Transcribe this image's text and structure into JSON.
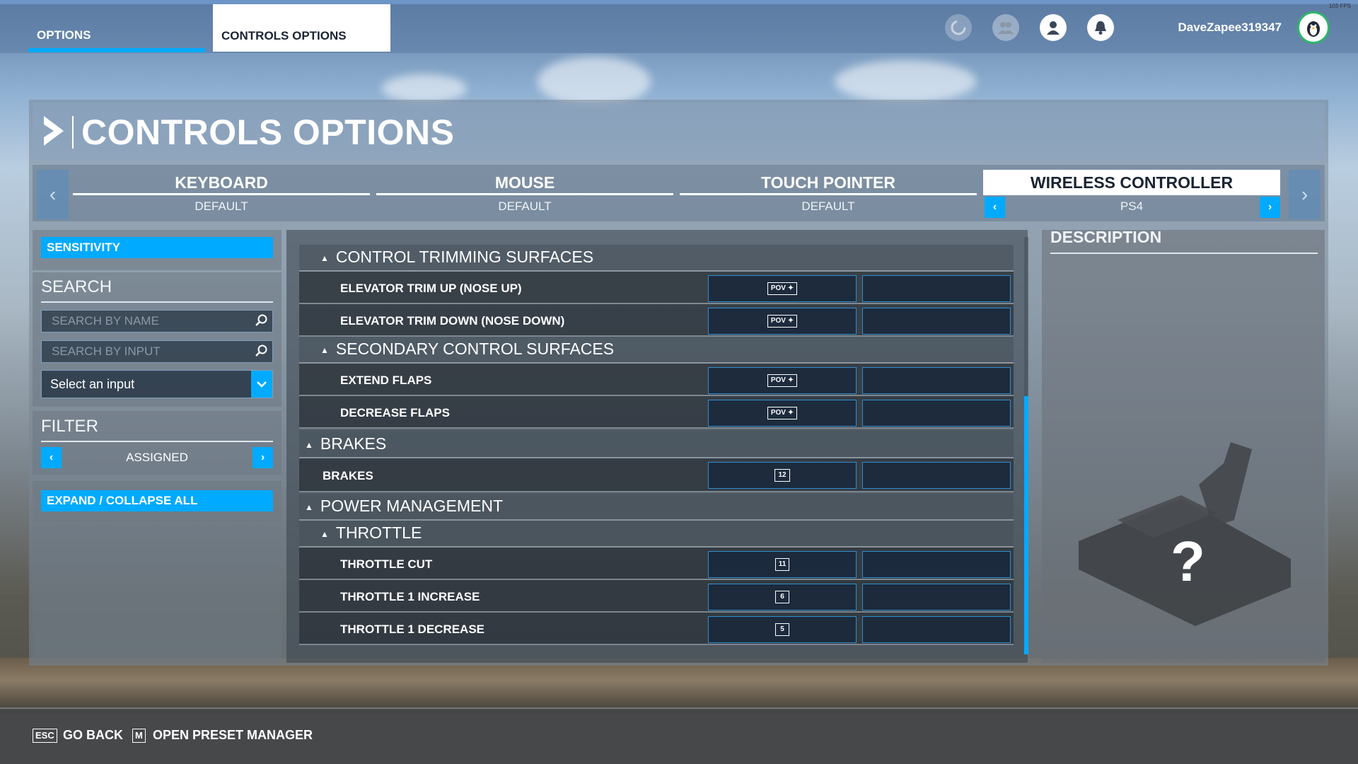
{
  "topbar": {
    "tab_options": "OPTIONS",
    "tab_controls": "CONTROLS OPTIONS",
    "username": "DaveZapee319347",
    "fps_text": "103 FPS",
    "icons": [
      "spinner-icon",
      "friends-icon",
      "profile-icon",
      "bell-icon"
    ]
  },
  "page_title": "CONTROLS OPTIONS",
  "devices": [
    {
      "name": "KEYBOARD",
      "preset": "DEFAULT"
    },
    {
      "name": "MOUSE",
      "preset": "DEFAULT"
    },
    {
      "name": "TOUCH POINTER",
      "preset": "DEFAULT"
    },
    {
      "name": "WIRELESS CONTROLLER",
      "preset": "PS4",
      "active": true
    }
  ],
  "sidebar": {
    "sensitivity": "SENSITIVITY",
    "search_heading": "SEARCH",
    "search_name_placeholder": "SEARCH BY NAME",
    "search_input_placeholder": "SEARCH BY INPUT",
    "select_input": "Select an input",
    "filter_heading": "FILTER",
    "filter_value": "ASSIGNED",
    "expand_collapse": "EXPAND / COLLAPSE ALL"
  },
  "list": {
    "cat_trim": "CONTROL TRIMMING SURFACES",
    "elev_up": "ELEVATOR TRIM UP (NOSE UP)",
    "elev_up_key": "POV ✦",
    "elev_down": "ELEVATOR TRIM DOWN (NOSE DOWN)",
    "elev_down_key": "POV ✦",
    "cat_secondary": "SECONDARY CONTROL SURFACES",
    "extend_flaps": "EXTEND FLAPS",
    "extend_flaps_key": "POV ✦",
    "decrease_flaps": "DECREASE FLAPS",
    "decrease_flaps_key": "POV ✦",
    "cat_brakes": "BRAKES",
    "brakes": "BRAKES",
    "brakes_key": "12",
    "cat_power": "POWER MANAGEMENT",
    "cat_throttle": "THROTTLE",
    "throttle_cut": "THROTTLE CUT",
    "throttle_cut_key": "11",
    "throttle_inc": "THROTTLE 1 INCREASE",
    "throttle_inc_key": "6",
    "throttle_dec": "THROTTLE 1 DECREASE",
    "throttle_dec_key": "5"
  },
  "description": {
    "heading": "DESCRIPTION",
    "placeholder": "?"
  },
  "footer": {
    "back_key": "ESC",
    "back_label": "GO BACK",
    "preset_key": "M",
    "preset_label": "OPEN PRESET MANAGER"
  },
  "colors": {
    "accent": "#00aaff",
    "panel": "#6e7884"
  }
}
